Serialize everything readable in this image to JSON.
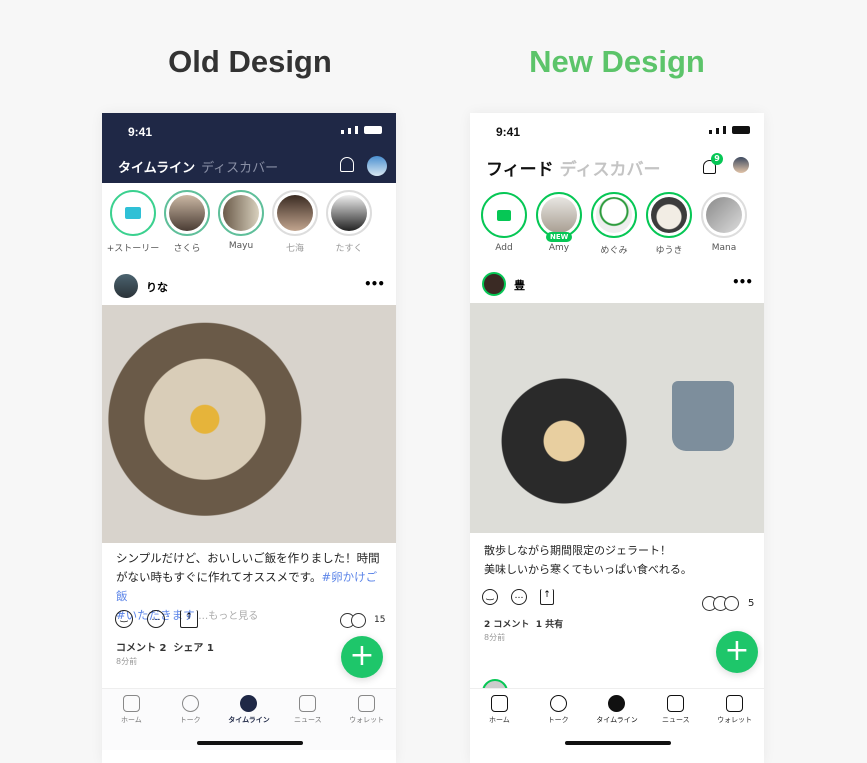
{
  "headings": {
    "old": "Old Design",
    "new": "New Design",
    "old_color": "#333333",
    "new_color": "#5cc46a"
  },
  "old": {
    "status_time": "9:41",
    "header_bg": "#1f2846",
    "tab_active": "タイムライン",
    "tab_inactive": "ディスカバー",
    "stories": [
      {
        "label": "+ストーリー"
      },
      {
        "label": "さくら"
      },
      {
        "label": "Mayu"
      },
      {
        "label": "七海"
      },
      {
        "label": "たすく"
      }
    ],
    "post": {
      "author": "りな",
      "caption": "シンプルだけど、おいしいご飯を作りました！時間がない時もすぐに作れてオススメです。",
      "tag1": "#卵かけご飯",
      "tag2": "#いただきます",
      "more": "…もっと見る",
      "reaction_count": "15",
      "comments": "コメント 2",
      "shares": "シェア 1",
      "time": "8分前"
    },
    "fab": "+",
    "nav": [
      {
        "label": "ホーム",
        "icon": "home-icon"
      },
      {
        "label": "トーク",
        "icon": "chat-icon"
      },
      {
        "label": "タイムライン",
        "icon": "clock-icon"
      },
      {
        "label": "ニュース",
        "icon": "news-icon"
      },
      {
        "label": "ウォレット",
        "icon": "wallet-icon"
      }
    ]
  },
  "new": {
    "status_time": "9:41",
    "tab_active": "フィード",
    "tab_inactive": "ディスカバー",
    "notification_badge": "9",
    "stories": [
      {
        "label": "Add"
      },
      {
        "label": "Amy",
        "badge": "NEW"
      },
      {
        "label": "めぐみ"
      },
      {
        "label": "ゆうき"
      },
      {
        "label": "Mana"
      }
    ],
    "post": {
      "author": "豊",
      "caption_line1": "散歩しながら期間限定のジェラート！",
      "caption_line2": "美味しいから寒くてもいっぱい食べれる。",
      "reaction_count": "5",
      "comments": "2 コメント",
      "shares": "1 共有",
      "time": "8分前"
    },
    "fab": "+",
    "accent": "#06c755",
    "nav": [
      {
        "label": "ホーム",
        "icon": "home-icon"
      },
      {
        "label": "トーク",
        "icon": "chat-icon"
      },
      {
        "label": "タイムライン",
        "icon": "clock-icon"
      },
      {
        "label": "ニュース",
        "icon": "news-icon"
      },
      {
        "label": "ウォレット",
        "icon": "wallet-icon"
      }
    ]
  }
}
